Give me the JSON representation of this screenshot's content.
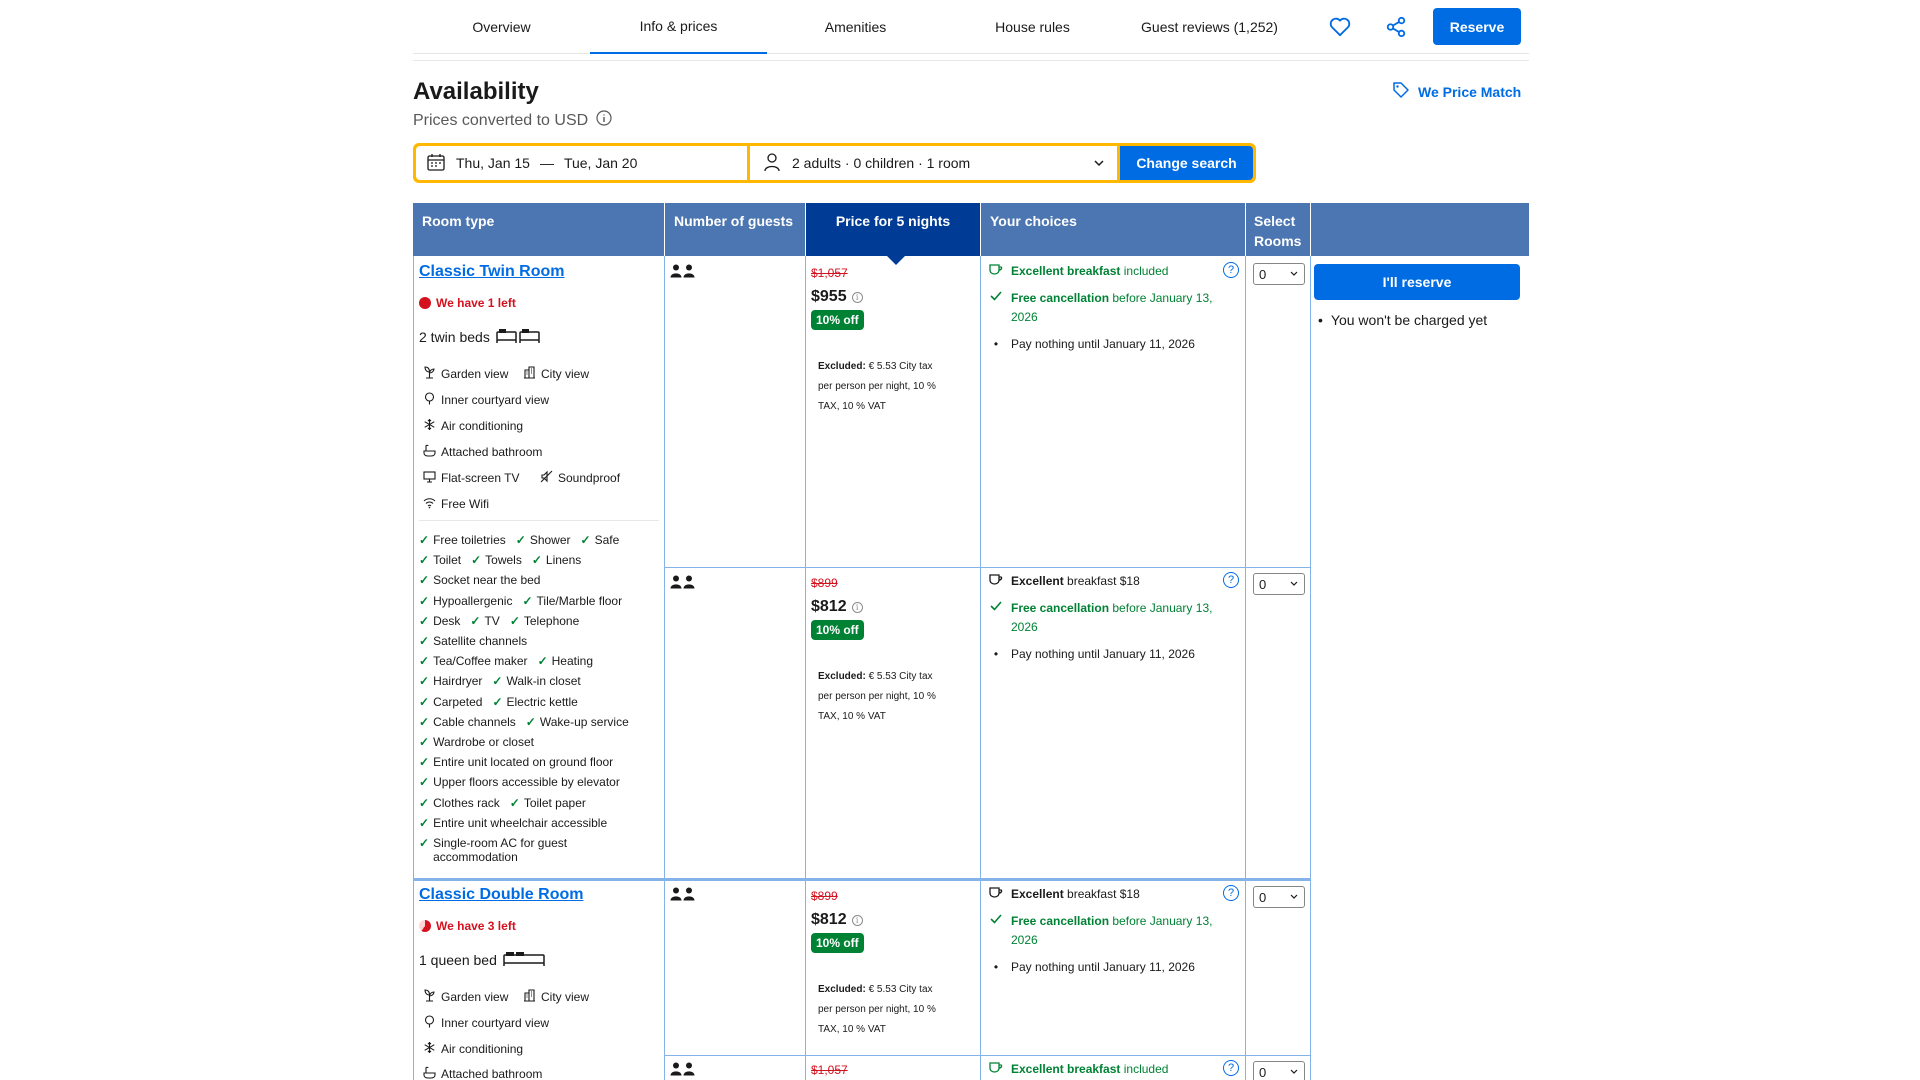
{
  "nav": {
    "tabs": [
      "Overview",
      "Info & prices",
      "Amenities",
      "House rules",
      "Guest reviews (1,252)"
    ],
    "reserve_label": "Reserve"
  },
  "header": {
    "title": "Availability",
    "subtitle": "Prices converted to USD",
    "price_match": "We Price Match"
  },
  "search": {
    "check_in": "Thu, Jan 15",
    "dash": "—",
    "check_out": "Tue, Jan 20",
    "guests": "2 adults · 0 children · 1 room",
    "button": "Change search"
  },
  "table_headers": {
    "room_type": "Room type",
    "guests": "Number of guests",
    "price": "Price for 5 nights",
    "choices": "Your choices",
    "select": "Select Rooms"
  },
  "rooms": [
    {
      "name": "Classic Twin Room",
      "scarcity": "We have 1 left",
      "bed": "2 twin beds",
      "features": [
        "Garden view",
        "City view",
        "Inner courtyard view",
        "Air conditioning",
        "Attached bathroom",
        "Flat-screen TV",
        "Soundproof",
        "Free Wifi"
      ],
      "amenities": [
        [
          "Free toiletries",
          "Shower",
          "Safe"
        ],
        [
          "Toilet",
          "Towels",
          "Linens"
        ],
        [
          "Socket near the bed"
        ],
        [
          "Hypoallergenic",
          "Tile/Marble floor"
        ],
        [
          "Desk",
          "TV",
          "Telephone"
        ],
        [
          "Satellite channels"
        ],
        [
          "Tea/Coffee maker",
          "Heating"
        ],
        [
          "Hairdryer",
          "Walk-in closet"
        ],
        [
          "Carpeted",
          "Electric kettle"
        ],
        [
          "Cable channels",
          "Wake-up service"
        ],
        [
          "Wardrobe or closet"
        ],
        [
          "Entire unit located on ground floor"
        ],
        [
          "Upper floors accessible by elevator"
        ],
        [
          "Clothes rack",
          "Toilet paper"
        ],
        [
          "Entire unit wheelchair accessible"
        ],
        [
          "Single-room AC for guest accommodation"
        ]
      ],
      "options": [
        {
          "old_price": "$1,057",
          "new_price": "$955",
          "discount": "10% off",
          "excluded_label": "Excluded:",
          "excluded": "€ 5.53 City tax per person per night, 10 % TAX, 10 % VAT",
          "breakfast_bold": "Excellent breakfast",
          "breakfast_rest": " included",
          "cancel_bold": "Free cancellation",
          "cancel_rest": " before January 13, 2026",
          "pay": "Pay nothing until January 11, 2026",
          "select": "0"
        },
        {
          "old_price": "$899",
          "new_price": "$812",
          "discount": "10% off",
          "excluded_label": "Excluded:",
          "excluded": "€ 5.53 City tax per person per night, 10 % TAX, 10 % VAT",
          "breakfast_bold": "Excellent",
          "breakfast_rest": " breakfast $18",
          "cancel_bold": "Free cancellation",
          "cancel_rest": " before January 13, 2026",
          "pay": "Pay nothing until January 11, 2026",
          "select": "0"
        }
      ]
    },
    {
      "name": "Classic Double Room",
      "scarcity": "We have 3 left",
      "bed": "1 queen bed",
      "features": [
        "Garden view",
        "City view",
        "Inner courtyard view",
        "Air conditioning",
        "Attached bathroom"
      ],
      "options": [
        {
          "old_price": "$899",
          "new_price": "$812",
          "discount": "10% off",
          "excluded_label": "Excluded:",
          "excluded": "€ 5.53 City tax per person per night, 10 % TAX, 10 % VAT",
          "breakfast_bold": "Excellent",
          "breakfast_rest": " breakfast $18",
          "cancel_bold": "Free cancellation",
          "cancel_rest": " before January 13, 2026",
          "pay": "Pay nothing until January 11, 2026",
          "select": "0"
        },
        {
          "old_price": "$1,057",
          "breakfast_bold": "Excellent breakfast",
          "breakfast_rest": " included",
          "select": "0"
        }
      ]
    }
  ],
  "sidebar": {
    "reserve_label": "I'll reserve",
    "note": "You won't be charged yet"
  },
  "colors": {
    "brand_blue": "#006ce4",
    "header_blue": "#4c76b2",
    "header_dark": "#003b95",
    "search_yellow": "#ffb700",
    "green": "#008234",
    "red": "#d4111e"
  }
}
